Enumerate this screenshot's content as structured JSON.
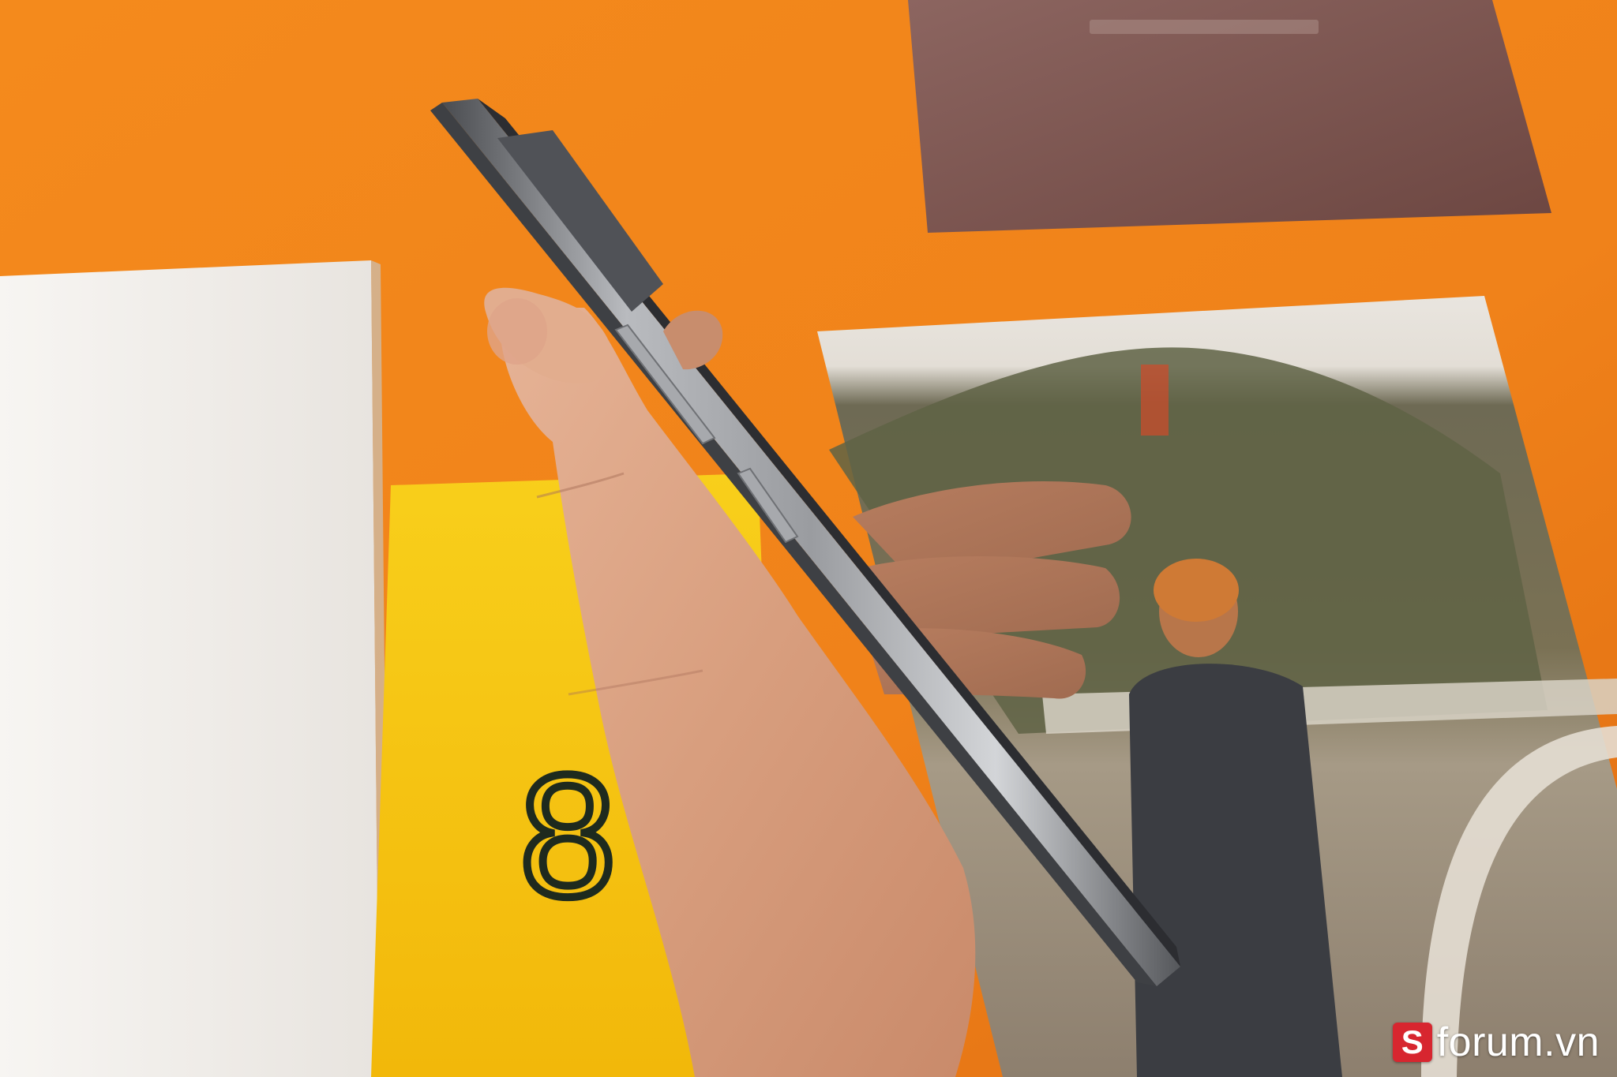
{
  "photo": {
    "description_colors": {
      "background_orange": "#f0861f",
      "white_card": "#f4f2ef",
      "yellow_box": "#f7c512",
      "brown_card": "#7d5550",
      "phone_frame": "#8c8e92",
      "skin": "#d9a283"
    }
  },
  "watermark": {
    "logo_letter": "S",
    "brand_text": "forum.vn",
    "logo_color": "#d7262f"
  }
}
